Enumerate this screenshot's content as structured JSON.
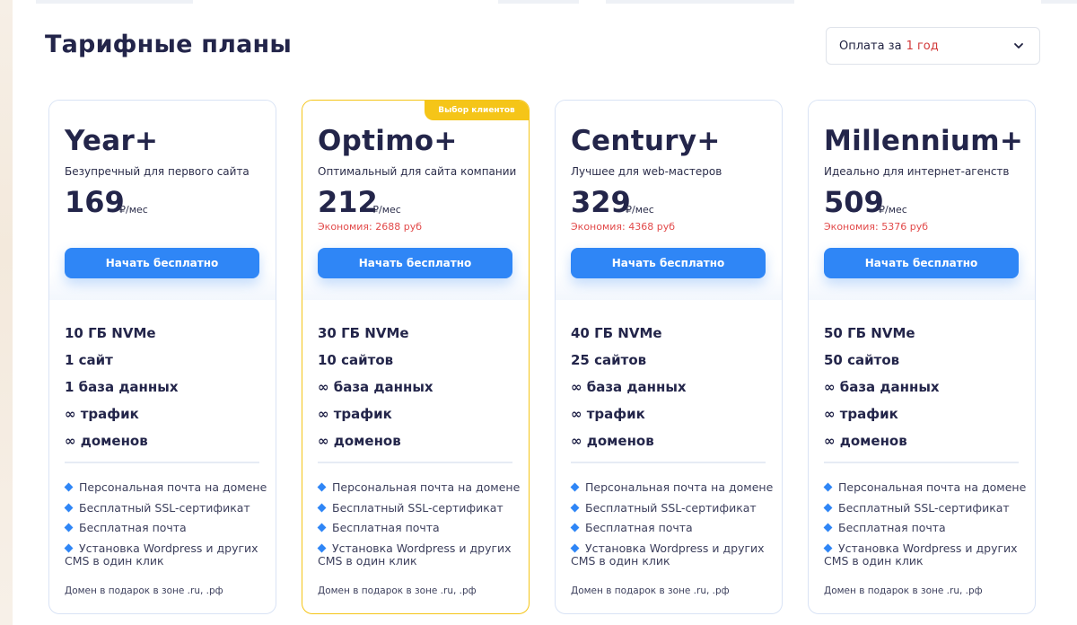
{
  "page": {
    "title": "Тарифные планы",
    "billing": {
      "prefix": "Оплата за",
      "period": "1 год"
    }
  },
  "colors": {
    "accent": "#2f86f6",
    "featured": "#f5c518",
    "savings": "#e24a4a",
    "text": "#23254a"
  },
  "plans": [
    {
      "name": "Year+",
      "description": "Безупречный для первого сайта",
      "price": "169",
      "unit": "₽/мес",
      "savings": "",
      "cta": "Начать бесплатно",
      "specs": [
        "10 ГБ NVMe",
        "1 сайт",
        "1 база данных",
        "∞ трафик",
        "∞ доменов"
      ],
      "features": [
        "Персональная почта на домене",
        "Бесплатный SSL-сертификат",
        "Бесплатная почта",
        "Установка Wordpress и других",
        "CMS в один клик"
      ],
      "gift": "Домен в подарок в зоне .ru, .рф"
    },
    {
      "name": "Optimo+",
      "badge": "Выбор клиентов",
      "description": "Оптимальный для сайта компании",
      "price": "212",
      "unit": "₽/мес",
      "savings": "Экономия: 2688 руб",
      "cta": "Начать бесплатно",
      "specs": [
        "30 ГБ NVMe",
        "10 сайтов",
        "∞ база данных",
        "∞ трафик",
        "∞ доменов"
      ],
      "features": [
        "Персональная почта на домене",
        "Бесплатный SSL-сертификат",
        "Бесплатная почта",
        "Установка Wordpress и других",
        "CMS в один клик"
      ],
      "gift": "Домен в подарок в зоне .ru, .рф"
    },
    {
      "name": "Century+",
      "description": "Лучшее для web-мастеров",
      "price": "329",
      "unit": "₽/мес",
      "savings": "Экономия: 4368 руб",
      "cta": "Начать бесплатно",
      "specs": [
        "40 ГБ NVMe",
        "25 сайтов",
        "∞ база данных",
        "∞ трафик",
        "∞ доменов"
      ],
      "features": [
        "Персональная почта на домене",
        "Бесплатный SSL-сертификат",
        "Бесплатная почта",
        "Установка Wordpress и других",
        "CMS в один клик"
      ],
      "gift": "Домен в подарок в зоне .ru, .рф"
    },
    {
      "name": "Millennium+",
      "description": "Идеально для интернет-агенств",
      "price": "509",
      "unit": "₽/мес",
      "savings": "Экономия: 5376 руб",
      "cta": "Начать бесплатно",
      "specs": [
        "50 ГБ NVMe",
        "50 сайтов",
        "∞ база данных",
        "∞ трафик",
        "∞ доменов"
      ],
      "features": [
        "Персональная почта на домене",
        "Бесплатный SSL-сертификат",
        "Бесплатная почта",
        "Установка Wordpress и других",
        "CMS в один клик"
      ],
      "gift": "Домен в подарок в зоне .ru, .рф"
    }
  ]
}
